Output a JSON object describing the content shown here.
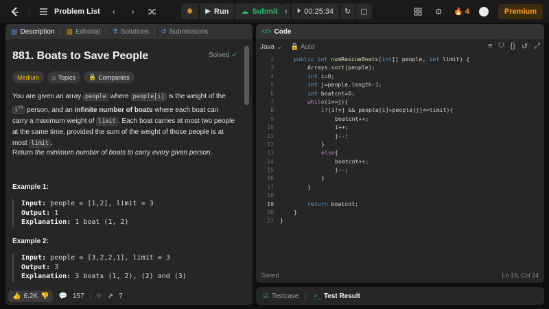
{
  "topbar": {
    "problem_list_label": "Problem List",
    "run_label": "Run",
    "submit_label": "Submit",
    "timer": "00:25:34",
    "streak_count": "4",
    "premium_label": "Premium"
  },
  "left_panel": {
    "tabs": [
      "Description",
      "Editorial",
      "Solutions",
      "Submissions"
    ],
    "title": "881. Boats to Save People",
    "status": "Solved",
    "badges": {
      "difficulty": "Medium",
      "topics": "Topics",
      "companies": "Companies"
    },
    "description": {
      "p1_a": "You are given an array",
      "code_people": "people",
      "p1_b": "where",
      "code_people_i": "people[i]",
      "p1_c": "is the weight of the",
      "sup_i": "i",
      "sup_th": "th",
      "p1_d": "person, and an",
      "p1_bold": "infinite number of boats",
      "p1_e": "where each boat can carry a maximum weight of",
      "code_limit": "limit",
      "p1_f": ". Each boat carries at most two people at the same time, provided the sum of the weight of those people is at most",
      "code_limit2": "limit",
      "p1_g": ".",
      "p2_a": "Return",
      "p2_em": "the minimum number of boats to carry every given person",
      "p2_b": "."
    },
    "examples": [
      {
        "title": "Example 1:",
        "input_label": "Input:",
        "input": "people = [1,2], limit = 3",
        "output_label": "Output:",
        "output": "1",
        "explanation_label": "Explanation:",
        "explanation": "1 boat (1, 2)"
      },
      {
        "title": "Example 2:",
        "input_label": "Input:",
        "input": "people = [3,2,2,1], limit = 3",
        "output_label": "Output:",
        "output": "3",
        "explanation_label": "Explanation:",
        "explanation": "3 boats (1, 2), (2) and (3)"
      }
    ],
    "footer": {
      "likes": "6.2K",
      "comments": "157"
    }
  },
  "editor": {
    "tab_label": "Code",
    "language": "Java",
    "autosave": "Auto",
    "status": "Saved",
    "cursor": "Ln 19, Col 24",
    "active_line": 19,
    "lines": [
      {
        "n": "2",
        "indent": 1,
        "text": "public int numRescueBoats(int[] people, int limit) {"
      },
      {
        "n": "3",
        "indent": 2,
        "text": "Arrays.sort(people);"
      },
      {
        "n": "4",
        "indent": 2,
        "text": "int i=0;"
      },
      {
        "n": "5",
        "indent": 2,
        "text": "int j=people.length-1;"
      },
      {
        "n": "6",
        "indent": 2,
        "text": "int boatcnt=0;"
      },
      {
        "n": "7",
        "indent": 2,
        "text": "while(i<=j){"
      },
      {
        "n": "8",
        "indent": 3,
        "text": "if(i!=j && people[i]+people[j]<=limit){"
      },
      {
        "n": "9",
        "indent": 4,
        "text": "boatcnt++;"
      },
      {
        "n": "10",
        "indent": 4,
        "text": "i++;"
      },
      {
        "n": "11",
        "indent": 4,
        "text": "j--;"
      },
      {
        "n": "12",
        "indent": 3,
        "text": "}"
      },
      {
        "n": "13",
        "indent": 3,
        "text": "else{"
      },
      {
        "n": "14",
        "indent": 4,
        "text": "boatcnt++;"
      },
      {
        "n": "15",
        "indent": 4,
        "text": "j--;"
      },
      {
        "n": "16",
        "indent": 3,
        "text": "}"
      },
      {
        "n": "17",
        "indent": 2,
        "text": "}"
      },
      {
        "n": "18",
        "indent": 0,
        "text": ""
      },
      {
        "n": "19",
        "indent": 2,
        "text": "return boatcnt;"
      },
      {
        "n": "20",
        "indent": 1,
        "text": "}"
      },
      {
        "n": "21",
        "indent": 0,
        "text": "}"
      }
    ]
  },
  "bottom": {
    "testcase_label": "Testcase",
    "result_label": "Test Result"
  },
  "colors": {
    "accent_orange": "#ffa116",
    "submit_green": "#2cbb5d",
    "medium_yellow": "#ffb800"
  }
}
